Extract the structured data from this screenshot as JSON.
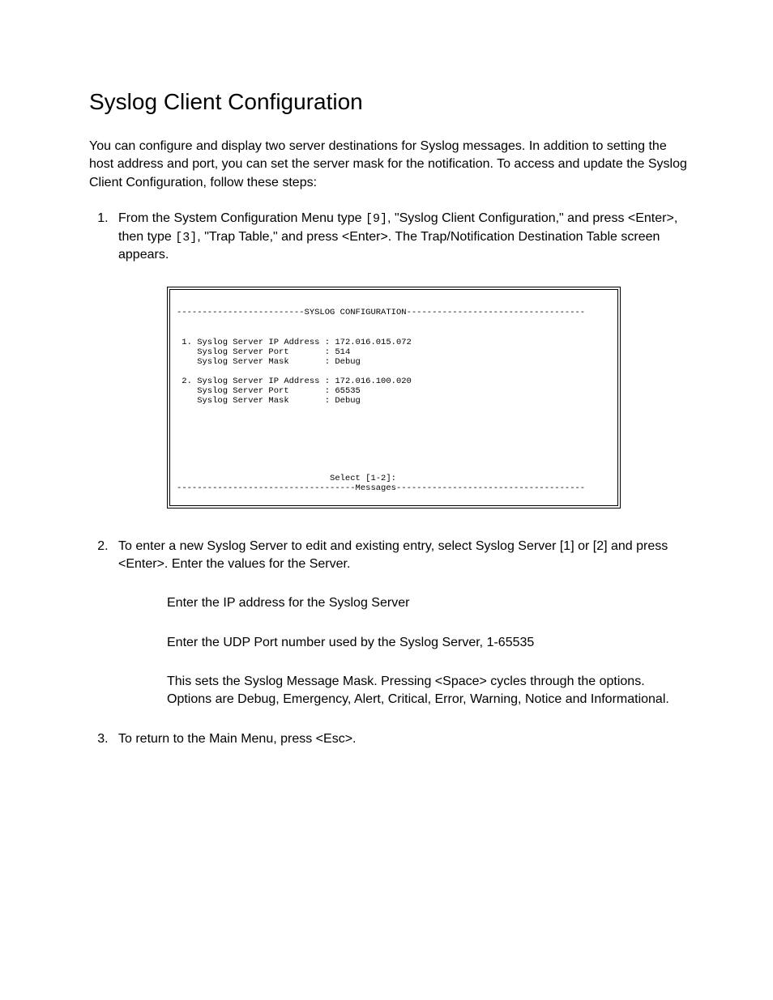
{
  "title": "Syslog Client Configuration",
  "intro": "You can configure and display two server destinations for Syslog messages. In addition to setting the host address and port, you can set the server mask for the notification. To access and update the Syslog Client Configuration, follow these steps:",
  "step1": {
    "pre": "From the System Configuration Menu type ",
    "key1": "[9]",
    "mid1": ", \"Syslog Client Configuration,\" and press <Enter>, then type ",
    "key2": "[3]",
    "mid2": ", \"Trap Table,\" and press <Enter>. The Trap/Notification Destination Table screen appears."
  },
  "terminal": {
    "header_left": "-------------------------",
    "header_title": "SYSLOG CONFIGURATION",
    "header_right": "-----------------------------------",
    "server1": {
      "ip_label": " 1. Syslog Server IP Address : ",
      "ip_value": "172.016.015.072",
      "port_label": "    Syslog Server Port       : ",
      "port_value": "514",
      "mask_label": "    Syslog Server Mask       : ",
      "mask_value": "Debug"
    },
    "server2": {
      "ip_label": " 2. Syslog Server IP Address : ",
      "ip_value": "172.016.100.020",
      "port_label": "    Syslog Server Port       : ",
      "port_value": "65535",
      "mask_label": "    Syslog Server Mask       : ",
      "mask_value": "Debug"
    },
    "select_prompt": "                              Select [1-2]:",
    "footer_left": "-----------------------------------",
    "footer_title": "Messages",
    "footer_right": "-------------------------------------"
  },
  "step2": {
    "text": "To enter a new Syslog Server to edit and existing entry, select Syslog Server [1] or [2] and press <Enter>. Enter the values for the Server.",
    "sub1": "Enter the IP address for the Syslog Server",
    "sub2": "Enter the UDP Port number used by the Syslog Server, 1-65535",
    "sub3": "This sets the Syslog Message Mask. Pressing <Space> cycles through the options. Options are Debug, Emergency, Alert, Critical, Error, Warning, Notice and Informational."
  },
  "step3": "To return to the Main Menu, press <Esc>."
}
